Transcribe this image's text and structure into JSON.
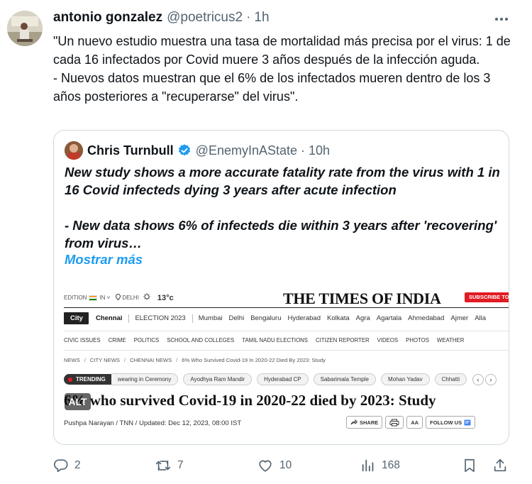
{
  "tweet": {
    "author_name": "antonio gonzalez",
    "handle": "@poetricus2",
    "separator": "·",
    "time": "1h",
    "text": "\"Un nuevo estudio muestra una tasa de mortalidad más precisa por el virus: 1 de cada 16 infectados por Covid muere 3 años después de la infección aguda.\n- Nuevos datos muestran que el 6% de los infectados mueren dentro de los 3 años posteriores a \"recuperarse\" del virus\"."
  },
  "quote": {
    "author_name": "Chris Turnbull",
    "handle": "@EnemyInAState",
    "separator": "·",
    "time": "10h",
    "text": "New study shows a more accurate fatality rate from the virus with 1 in 16 Covid infecteds dying 3 years after acute infection\n\n- New data shows 6% of infecteds die within 3 years after 'recovering' from virus…",
    "show_more": "Mostrar más"
  },
  "article": {
    "edition_label": "EDITION",
    "edition_value": "IN",
    "city": "DELHI",
    "temperature": "13°c",
    "logo": "THE TIMES OF INDIA",
    "subscribe": "SUBSCRIBE TO",
    "city_badge": "City",
    "city_active": "Chennai",
    "city_items": [
      "ELECTION 2023",
      "Mumbai",
      "Delhi",
      "Bengaluru",
      "Hyderabad",
      "Kolkata",
      "Agra",
      "Agartala",
      "Ahmedabad",
      "Ajmer",
      "Alla"
    ],
    "sub_nav": [
      "CIVIC ISSUES",
      "CRIME",
      "POLITICS",
      "SCHOOL AND COLLEGES",
      "TAMIL NADU ELECTIONS",
      "CITIZEN REPORTER",
      "VIDEOS",
      "PHOTOS",
      "WEATHER"
    ],
    "breadcrumbs": [
      "NEWS",
      "CITY NEWS",
      "CHENNAI NEWS",
      "6% Who Survived Covid-19 In 2020-22 Died By 2023: Study"
    ],
    "trending_label": "TRENDING",
    "trending": [
      "wearing in Ceremony",
      "Ayodhya Ram Mandir",
      "Hyderabad CP",
      "Sabarimala Temple",
      "Mohan Yadav",
      "Chhatti"
    ],
    "headline": "6% who survived Covid-19 in 2020-22 died by 2023: Study",
    "byline": "Pushpa Narayan / TNN / Updated: Dec 12, 2023, 08:00 IST",
    "share": "SHARE",
    "aa": "AA",
    "follow": "FOLLOW US",
    "alt_badge": "ALT"
  },
  "actions": {
    "replies": "2",
    "retweets": "7",
    "likes": "10",
    "views": "168"
  },
  "colors": {
    "text": "#0f1419",
    "secondary": "#536471",
    "link": "#1d9bf0",
    "verified": "#1d9bf0",
    "border": "#cfd9de",
    "toi_red": "#e21b22"
  },
  "icons": [
    "avatar",
    "more-icon",
    "verified-badge-icon",
    "reply-icon",
    "retweet-icon",
    "like-icon",
    "views-icon",
    "bookmark-icon",
    "share-icon"
  ]
}
